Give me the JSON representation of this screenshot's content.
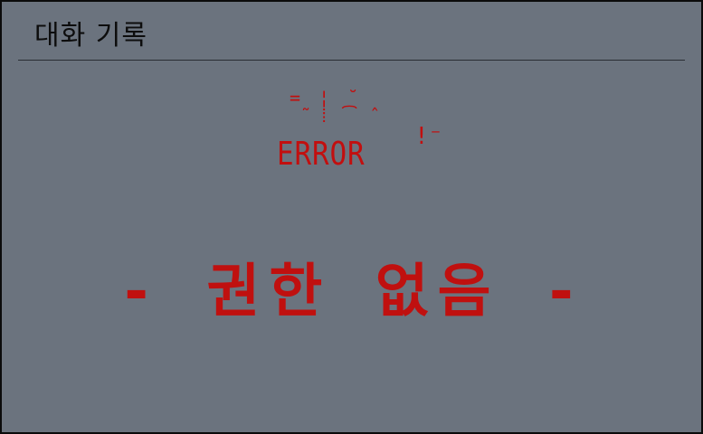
{
  "window": {
    "title": "대화 기록"
  },
  "error": {
    "noise": "= ¦ ˘\n ̃ ⁞ ͡ ̂ ",
    "label": "ERROR",
    "mark": "!⁻",
    "message": "- 권한 없음 -"
  },
  "colors": {
    "background": "#6b737e",
    "title_text": "#0d0d0d",
    "error_red": "#c20f0f",
    "divider": "#2a2d33"
  }
}
